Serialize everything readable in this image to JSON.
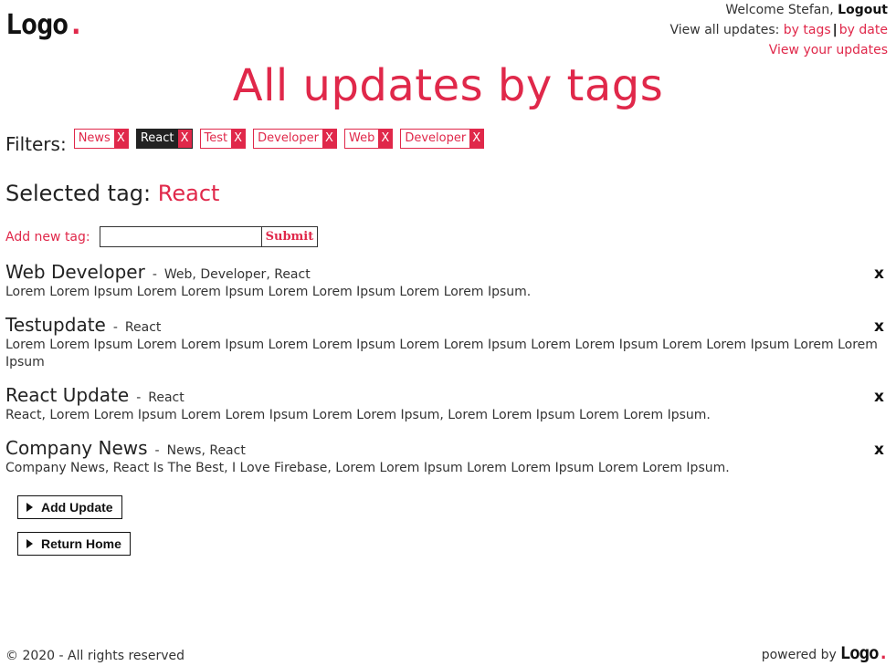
{
  "header": {
    "logo_text": "Logo",
    "logo_dot": ".",
    "welcome": "Welcome Stefan,",
    "logout": "Logout",
    "view_all_label": "View all updates:",
    "by_tags": "by tags",
    "separator": "|",
    "by_date": "by date",
    "view_yours": "View your updates"
  },
  "page_title": "All updates by tags",
  "filters": {
    "label": "Filters:",
    "remove_glyph": "X",
    "chips": [
      {
        "label": "News",
        "active": false
      },
      {
        "label": "React",
        "active": true
      },
      {
        "label": "Test",
        "active": false
      },
      {
        "label": "Developer",
        "active": false
      },
      {
        "label": "Web",
        "active": false
      },
      {
        "label": "Developer",
        "active": false
      }
    ]
  },
  "selected": {
    "label": "Selected tag:",
    "value": "React"
  },
  "add_tag": {
    "label": "Add new tag:",
    "value": "",
    "submit": "Submit"
  },
  "updates": [
    {
      "title": "Web Developer",
      "dash": "-",
      "tags": "Web, Developer, React",
      "body": "Lorem Lorem Ipsum Lorem Lorem Ipsum Lorem Lorem Ipsum Lorem Lorem Ipsum.",
      "remove": "x"
    },
    {
      "title": "Testupdate",
      "dash": "-",
      "tags": "React",
      "body": "Lorem Lorem Ipsum Lorem Lorem Ipsum Lorem Lorem Ipsum Lorem Lorem Ipsum Lorem Lorem Ipsum Lorem Lorem Ipsum Lorem Lorem Ipsum",
      "remove": "x"
    },
    {
      "title": "React Update",
      "dash": "-",
      "tags": "React",
      "body": "React, Lorem Lorem Ipsum Lorem Lorem Ipsum Lorem Lorem Ipsum, Lorem Lorem Ipsum Lorem Lorem Ipsum.",
      "remove": "x"
    },
    {
      "title": "Company News",
      "dash": "-",
      "tags": "News, React",
      "body": "Company News, React Is The Best, I Love Firebase, Lorem Lorem Ipsum Lorem Lorem Ipsum Lorem Lorem Ipsum.",
      "remove": "x"
    }
  ],
  "actions": {
    "add_update": "Add Update",
    "return_home": "Return Home"
  },
  "footer": {
    "copyright": "© 2020 - All rights reserved",
    "powered_by": "powered by",
    "logo_text": "Logo",
    "logo_dot": "."
  },
  "colors": {
    "accent": "#e0284a",
    "text": "#333333",
    "dark": "#111111"
  }
}
